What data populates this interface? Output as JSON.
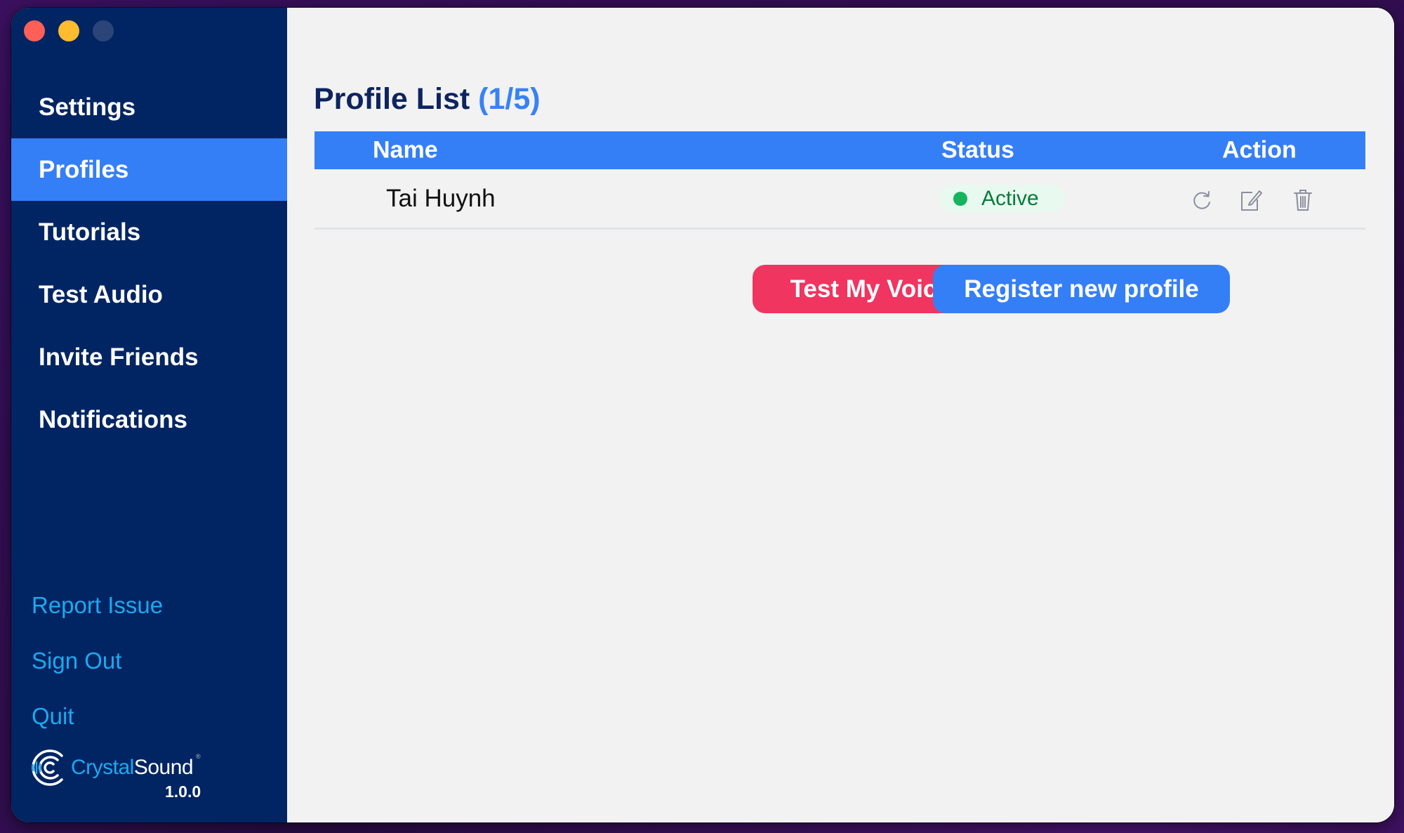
{
  "window": {
    "controls": [
      "close",
      "minimize",
      "maximize"
    ]
  },
  "sidebar": {
    "items": [
      {
        "label": "Settings",
        "active": false
      },
      {
        "label": "Profiles",
        "active": true
      },
      {
        "label": "Tutorials",
        "active": false
      },
      {
        "label": "Test Audio",
        "active": false
      },
      {
        "label": "Invite Friends",
        "active": false
      },
      {
        "label": "Notifications",
        "active": false
      }
    ],
    "links": [
      "Report Issue",
      "Sign Out",
      "Quit"
    ],
    "brand": {
      "part1": "Crystal",
      "part2": "Sound",
      "reg": "®",
      "version": "1.0.0"
    }
  },
  "main": {
    "title": "Profile List",
    "count": "(1/5)",
    "table": {
      "headers": {
        "name": "Name",
        "status": "Status",
        "action": "Action"
      },
      "rows": [
        {
          "name": "Tai Huynh",
          "status": "Active",
          "actions": [
            "refresh-icon",
            "edit-icon",
            "trash-icon"
          ]
        }
      ]
    },
    "buttons": {
      "test_voice": "Test My Voice Only",
      "register": "Register new profile"
    }
  },
  "colors": {
    "sidebar_bg": "#012563",
    "accent_blue": "#357ff6",
    "danger_red": "#ef3560",
    "link_cyan": "#1ea8ee",
    "status_active": "#17b35e"
  }
}
